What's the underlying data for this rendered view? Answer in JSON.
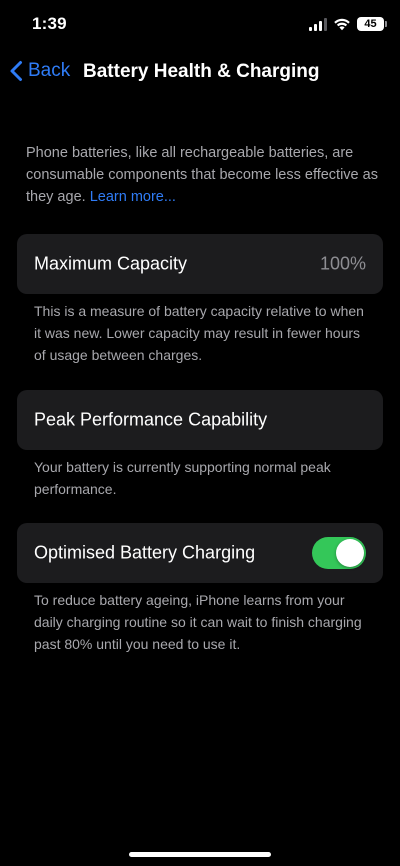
{
  "status_bar": {
    "time": "1:39",
    "battery_level": "45"
  },
  "nav": {
    "back_label": "Back",
    "title": "Battery Health & Charging"
  },
  "intro": {
    "text": "Phone batteries, like all rechargeable batteries, are consumable components that become less effective as they age.",
    "learn_more": "Learn more..."
  },
  "maximum_capacity": {
    "label": "Maximum Capacity",
    "value": "100%",
    "footnote": "This is a measure of battery capacity relative to when it was new. Lower capacity may result in fewer hours of usage between charges."
  },
  "peak_performance": {
    "label": "Peak Performance Capability",
    "footnote": "Your battery is currently supporting normal peak performance."
  },
  "optimised_charging": {
    "label": "Optimised Battery Charging",
    "enabled": true,
    "footnote": "To reduce battery ageing, iPhone learns from your daily charging routine so it can wait to finish charging past 80% until you need to use it."
  },
  "colors": {
    "accent": "#2f7cf6",
    "toggle_on": "#34c759",
    "card_bg": "#1c1c1e",
    "secondary_text": "#a8a8ad"
  }
}
